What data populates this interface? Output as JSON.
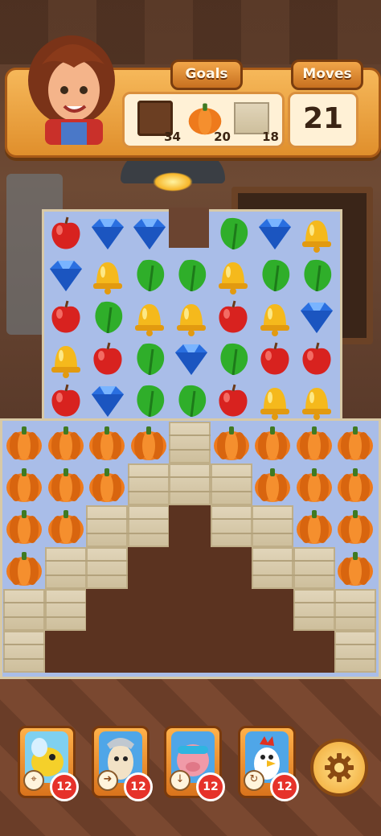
{
  "header": {
    "goals_label": "Goals",
    "moves_label": "Moves",
    "moves_remaining": "21",
    "goals": [
      {
        "name": "dirt-tile-goal",
        "count": "34"
      },
      {
        "name": "pumpkin-goal",
        "count": "20"
      },
      {
        "name": "brick-goal",
        "count": "18"
      }
    ]
  },
  "board": {
    "rows": [
      [
        "apple",
        "blue-gem",
        "blue-gem",
        null,
        "leaf",
        "blue-gem",
        "bell"
      ],
      [
        "blue-gem",
        "bell",
        "leaf",
        "leaf",
        "bell",
        "leaf",
        "leaf"
      ],
      [
        "apple",
        "leaf",
        "bell",
        "bell",
        "apple",
        "bell",
        "blue-gem"
      ],
      [
        "bell",
        "apple",
        "leaf",
        "blue-gem",
        "leaf",
        "apple",
        "apple"
      ],
      [
        "apple",
        "blue-gem",
        "leaf",
        "leaf",
        "apple",
        "bell",
        "bell"
      ]
    ],
    "lower_rows": [
      [
        "pumpkin",
        "pumpkin",
        "pumpkin",
        "pumpkin",
        "brick",
        "pumpkin",
        "pumpkin",
        "pumpkin",
        "pumpkin"
      ],
      [
        "pumpkin",
        "pumpkin",
        "pumpkin",
        "brick",
        "brick",
        "brick",
        "pumpkin",
        "pumpkin",
        "pumpkin"
      ],
      [
        "pumpkin",
        "pumpkin",
        "brick",
        "brick",
        "dirt",
        "brick",
        "brick",
        "pumpkin",
        "pumpkin"
      ],
      [
        "pumpkin",
        "brick",
        "brick",
        "dirt",
        "dirt",
        "dirt",
        "brick",
        "brick",
        "pumpkin"
      ],
      [
        "brick",
        "brick",
        "dirt",
        "dirt",
        "dirt",
        "dirt",
        "dirt",
        "brick",
        "brick"
      ],
      [
        "brick",
        "dirt",
        "dirt",
        "dirt",
        "dirt",
        "dirt",
        "dirt",
        "dirt",
        "brick"
      ]
    ]
  },
  "boosters": [
    {
      "name": "bee",
      "count": "12",
      "icon": "target-icon"
    },
    {
      "name": "goat",
      "count": "12",
      "icon": "arrow-icon"
    },
    {
      "name": "pig",
      "count": "12",
      "icon": "arrow-down-icon"
    },
    {
      "name": "rooster",
      "count": "12",
      "icon": "shuffle-icon"
    }
  ],
  "colors": {
    "apple": "#d8221f",
    "blue_gem": "#2a6fe0",
    "leaf": "#2fae2a",
    "bell": "#f5b91c",
    "pumpkin": "#ee7a1c"
  }
}
